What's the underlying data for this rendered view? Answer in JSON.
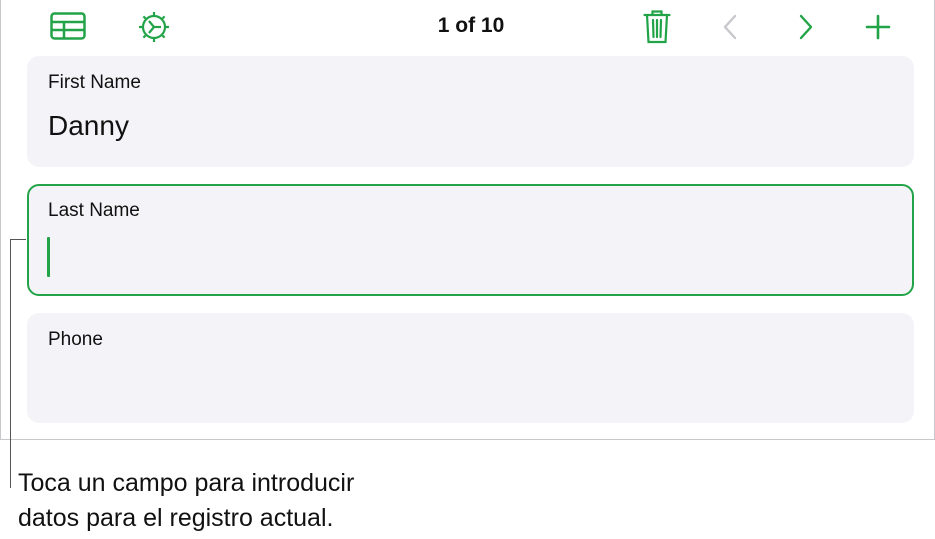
{
  "toolbar": {
    "record_counter": "1 of 10",
    "icons": [
      "table-icon",
      "gear-clock-icon",
      "trash-icon",
      "chevron-left-icon",
      "chevron-right-icon",
      "plus-icon"
    ]
  },
  "fields": [
    {
      "label": "First Name",
      "value": "Danny"
    },
    {
      "label": "Last Name",
      "value": ""
    },
    {
      "label": "Phone",
      "value": ""
    }
  ],
  "callout": {
    "line1": "Toca un campo para introducir",
    "line2": "datos para el registro actual."
  },
  "colors": {
    "accent": "#22a348",
    "card_bg": "#f4f4f8",
    "disabled": "#c7c7cc"
  }
}
